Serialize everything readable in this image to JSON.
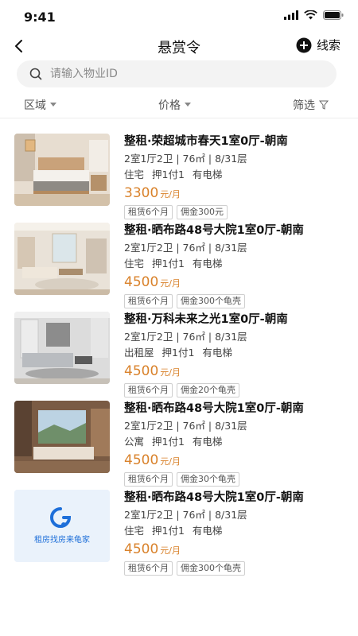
{
  "status_bar": {
    "time": "9:41"
  },
  "nav": {
    "title": "悬赏令",
    "lead_label": "线索"
  },
  "search": {
    "placeholder": "请输入物业ID"
  },
  "filters": {
    "area": "区域",
    "price": "价格",
    "filter": "筛选"
  },
  "listings": [
    {
      "title": "整租·荣超城市春天1室0厅-朝南",
      "specs": "2室1厅2卫 | 76㎡ | 8/31层",
      "type": "住宅",
      "payment": "押1付1",
      "elevator": "有电梯",
      "price": "3300",
      "price_unit": "元/月",
      "tags": [
        "租赁6个月",
        "佣金300元"
      ],
      "image": "bedroom-photo"
    },
    {
      "title": "整租·晒布路48号大院1室0厅-朝南",
      "specs": "2室1厅2卫 | 76㎡ | 8/31层",
      "type": "住宅",
      "payment": "押1付1",
      "elevator": "有电梯",
      "price": "4500",
      "price_unit": "元/月",
      "tags": [
        "租赁6个月",
        "佣金300个龟壳"
      ],
      "image": "living-room-photo"
    },
    {
      "title": "整租·万科未来之光1室0厅-朝南",
      "specs": "2室1厅2卫 | 76㎡ | 8/31层",
      "type": "出租屋",
      "payment": "押1付1",
      "elevator": "有电梯",
      "price": "4500",
      "price_unit": "元/月",
      "tags": [
        "租赁6个月",
        "佣金20个龟壳"
      ],
      "image": "modern-living-room-photo"
    },
    {
      "title": "整租·晒布路48号大院1室0厅-朝南",
      "specs": "2室1厅2卫 | 76㎡ | 8/31层",
      "type": "公寓",
      "payment": "押1付1",
      "elevator": "有电梯",
      "price": "4500",
      "price_unit": "元/月",
      "tags": [
        "租赁6个月",
        "佣金30个龟壳"
      ],
      "image": "bedroom-view-photo"
    },
    {
      "title": "整租·晒布路48号大院1室0厅-朝南",
      "specs": "2室1厅2卫 | 76㎡ | 8/31层",
      "type": "住宅",
      "payment": "押1付1",
      "elevator": "有电梯",
      "price": "4500",
      "price_unit": "元/月",
      "tags": [
        "租赁6个月",
        "佣金300个龟壳"
      ],
      "image": "logo-placeholder",
      "logo_text": "租房找房来龟家"
    }
  ],
  "colors": {
    "price": "#d9822b",
    "logo_blue": "#1e6fd9",
    "search_bg": "#f3f3f3"
  }
}
